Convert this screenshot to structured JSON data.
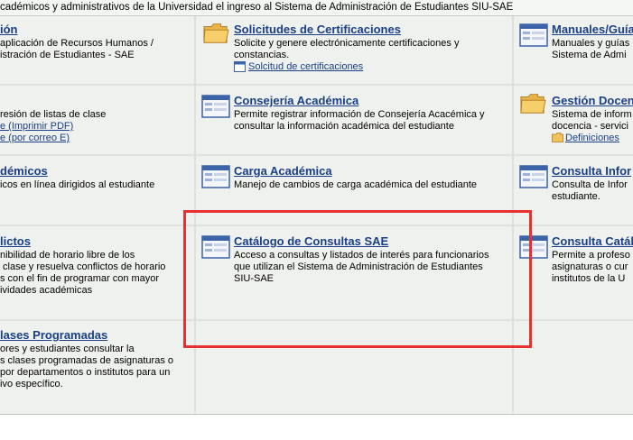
{
  "header": {
    "intro": "cadémicos y administrativos de la Universidad el ingreso al Sistema de Administración de Estudiantes SIU-SAE"
  },
  "cells": {
    "c1r1": {
      "title": "ión",
      "desc": "aplicación de Recursos Humanos /\nistración de Estudiantes - SAE"
    },
    "c2r1": {
      "title": "Solicitudes de Certificaciones",
      "desc": "Solicite y genere electrónicamente certificaciones y\nconstancias.",
      "link": "Solcitud de certificaciones"
    },
    "c3r1": {
      "title": "Manuales/Guía",
      "desc": "Manuales y guías\nSistema de Admi"
    },
    "c1r2": {
      "title": "",
      "desc": "resión de listas de clase",
      "link1": "e (Imprimir PDF)",
      "link2": "e (por correo E)"
    },
    "c2r2": {
      "title": "Consejería Académica",
      "desc": "Permite registrar información de Consejería Acacémica y\nconsultar la información académica del estudiante"
    },
    "c3r2": {
      "title": "Gestión Docen",
      "desc": "Sistema de inform\ndocencia - servici",
      "link": "Definiciones"
    },
    "c1r3": {
      "title": "démicos",
      "desc": "icos en línea dirigidos al estudiante"
    },
    "c2r3": {
      "title": "Carga Académica",
      "desc": "Manejo de cambios de carga académica del estudiante"
    },
    "c3r3": {
      "title": "Consulta Infor",
      "desc": "Consulta de Infor\nestudiante."
    },
    "c1r4": {
      "title": "lictos",
      "desc": "nibilidad de horario libre de los\n clase y resuelva conflictos de horario\ns con el fin de programar con mayor\nividades académicas"
    },
    "c2r4": {
      "title": "Catálogo de Consultas SAE",
      "desc": "Acceso a consultas y listados de interés para funcionarios\nque utilizan el Sistema de Administración de Estudiantes\nSIU-SAE"
    },
    "c3r4": {
      "title": "Consulta Catál",
      "desc": "Permite a profeso\nasignaturas o cur\ninstitutos de la U"
    },
    "c1r5": {
      "title": "lases Programadas",
      "desc": "ores y estudiantes consultar la\ns clases programadas de asignaturas o\npor departamentos o institutos para un\nivo específico."
    }
  },
  "icons": {
    "c2r1": "folder-icon",
    "c3r1": "window-icon",
    "c2r2": "window-icon",
    "c3r2": "folder-icon",
    "c2r3": "window-icon",
    "c3r3": "window-icon",
    "c2r4": "window-icon",
    "c3r4": "window-icon"
  },
  "colors": {
    "link": "#1a3f86",
    "highlight": "#e8302e",
    "cell_bg": "#eff1ee"
  }
}
